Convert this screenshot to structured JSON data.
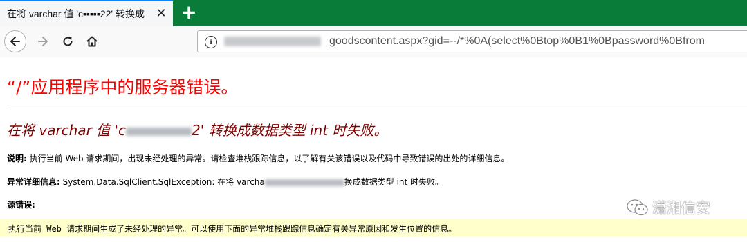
{
  "browser": {
    "tab_title": "在将 varchar 值 'c▪▪▪▪▪22' 转换成",
    "close_glyph": "✕",
    "new_tab_glyph": "+",
    "url_visible": "goodscontent.aspx?gid=--/*%0A(select%0Btop%0B1%0Bpassword%0Bfrom"
  },
  "page": {
    "title": "“/”应用程序中的服务器错误。",
    "error_heading_prefix": "在将 varchar 值 'c",
    "error_heading_suffix": "2' 转换成数据类型 int 时失败。",
    "description_label": "说明:",
    "description_text": " 执行当前 Web 请求期间，出现未经处理的异常。请检查堆栈跟踪信息，以了解有关该错误以及代码中导致错误的出处的详细信息。",
    "exception_label": "异常详细信息:",
    "exception_text_prefix": " System.Data.SqlClient.SqlException: 在将 varcha",
    "exception_text_suffix": "换成数据类型 int 时失败。",
    "source_error_label": "源错误:",
    "source_box_text": "执行当前 Web 请求期间生成了未经处理的异常。可以使用下面的异常堆栈跟踪信息确定有关异常原因和发生位置的信息。"
  },
  "watermark": {
    "text": "潇湘信安"
  },
  "colors": {
    "tabstrip": "#0a7c3a",
    "title_red": "#ff0000",
    "heading_maroon": "#800000",
    "source_box_bg": "#ffffcc"
  },
  "icons": [
    "close-icon",
    "plus-icon",
    "back-arrow-icon",
    "forward-arrow-icon",
    "reload-icon",
    "home-icon",
    "info-icon",
    "wechat-icon"
  ]
}
